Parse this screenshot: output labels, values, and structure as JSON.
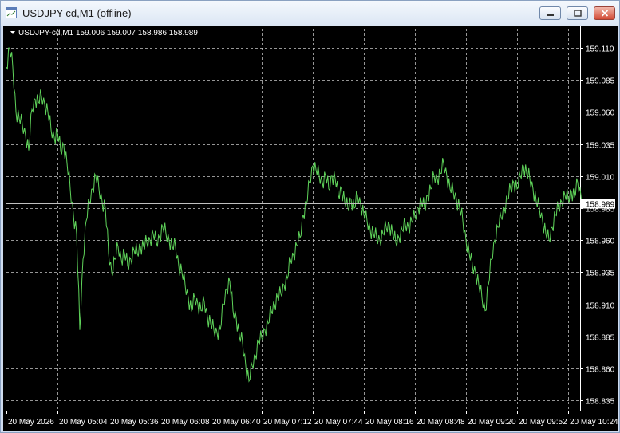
{
  "window": {
    "title": "USDJPY-cd,M1 (offline)",
    "buttons": [
      "minimize",
      "maximize",
      "close"
    ]
  },
  "chart_data": {
    "type": "line",
    "header": {
      "symbol": "USDJPY-cd,M1",
      "ohlc": "159.006 159.007 158.986 158.989"
    },
    "colors": {
      "background": "#000000",
      "bars": "#5fd35a",
      "grid": "#c8c8c8",
      "current_line": "#c0c0c0"
    },
    "grid": true,
    "y_ticks": [
      "159.110",
      "159.085",
      "159.060",
      "159.035",
      "159.010",
      "158.985",
      "158.960",
      "158.935",
      "158.910",
      "158.885",
      "158.860",
      "158.835"
    ],
    "ylim": [
      158.827,
      159.125
    ],
    "current_price": "158.989",
    "x_ticks": [
      "20 May 2026",
      "20 May 05:04",
      "20 May 05:36",
      "20 May 06:08",
      "20 May 06:40",
      "20 May 07:12",
      "20 May 07:44",
      "20 May 08:16",
      "20 May 08:48",
      "20 May 09:20",
      "20 May 09:52",
      "20 May 10:24"
    ],
    "series": [
      {
        "points": [
          [
            0,
            159.095
          ],
          [
            4,
            159.11
          ],
          [
            8,
            159.095
          ],
          [
            12,
            159.06
          ],
          [
            16,
            159.055
          ],
          [
            20,
            159.05
          ],
          [
            24,
            159.042
          ],
          [
            28,
            159.03
          ],
          [
            32,
            159.062
          ],
          [
            36,
            159.07
          ],
          [
            40,
            159.068
          ],
          [
            44,
            159.072
          ],
          [
            48,
            159.066
          ],
          [
            52,
            159.06
          ],
          [
            56,
            159.046
          ],
          [
            60,
            159.04
          ],
          [
            64,
            159.044
          ],
          [
            68,
            159.03
          ],
          [
            72,
            159.034
          ],
          [
            76,
            159.02
          ],
          [
            80,
            159.0
          ],
          [
            84,
            158.98
          ],
          [
            88,
            158.965
          ],
          [
            92,
            158.89
          ],
          [
            96,
            158.945
          ],
          [
            100,
            158.975
          ],
          [
            104,
            158.99
          ],
          [
            108,
            159.0
          ],
          [
            112,
            159.01
          ],
          [
            116,
            159.0
          ],
          [
            120,
            158.99
          ],
          [
            124,
            158.985
          ],
          [
            128,
            158.95
          ],
          [
            132,
            158.935
          ],
          [
            136,
            158.945
          ],
          [
            140,
            158.955
          ],
          [
            144,
            158.945
          ],
          [
            148,
            158.95
          ],
          [
            152,
            158.94
          ],
          [
            156,
            158.945
          ],
          [
            160,
            158.952
          ],
          [
            164,
            158.95
          ],
          [
            168,
            158.955
          ],
          [
            172,
            158.955
          ],
          [
            176,
            158.958
          ],
          [
            180,
            158.96
          ],
          [
            184,
            158.965
          ],
          [
            188,
            158.958
          ],
          [
            192,
            158.962
          ],
          [
            196,
            158.97
          ],
          [
            200,
            158.965
          ],
          [
            204,
            158.96
          ],
          [
            208,
            158.955
          ],
          [
            212,
            158.955
          ],
          [
            216,
            158.94
          ],
          [
            220,
            158.935
          ],
          [
            224,
            158.925
          ],
          [
            228,
            158.915
          ],
          [
            232,
            158.905
          ],
          [
            236,
            158.915
          ],
          [
            240,
            158.91
          ],
          [
            244,
            158.905
          ],
          [
            248,
            158.912
          ],
          [
            252,
            158.9
          ],
          [
            256,
            158.895
          ],
          [
            260,
            158.89
          ],
          [
            264,
            158.888
          ],
          [
            268,
            158.89
          ],
          [
            272,
            158.91
          ],
          [
            276,
            158.922
          ],
          [
            280,
            158.928
          ],
          [
            284,
            158.905
          ],
          [
            288,
            158.9
          ],
          [
            292,
            158.885
          ],
          [
            296,
            158.88
          ],
          [
            300,
            158.862
          ],
          [
            304,
            158.85
          ],
          [
            308,
            158.862
          ],
          [
            312,
            158.87
          ],
          [
            316,
            158.88
          ],
          [
            320,
            158.884
          ],
          [
            324,
            158.89
          ],
          [
            328,
            158.895
          ],
          [
            332,
            158.905
          ],
          [
            336,
            158.91
          ],
          [
            340,
            158.915
          ],
          [
            344,
            158.918
          ],
          [
            348,
            158.925
          ],
          [
            352,
            158.93
          ],
          [
            356,
            158.945
          ],
          [
            360,
            158.948
          ],
          [
            364,
            158.956
          ],
          [
            368,
            158.962
          ],
          [
            372,
            158.98
          ],
          [
            376,
            158.988
          ],
          [
            380,
            159.005
          ],
          [
            384,
            159.018
          ],
          [
            388,
            159.015
          ],
          [
            392,
            159.01
          ],
          [
            396,
            159.005
          ],
          [
            400,
            159.01
          ],
          [
            404,
            159.0
          ],
          [
            408,
            159.01
          ],
          [
            412,
            159.008
          ],
          [
            416,
            158.995
          ],
          [
            420,
            159.0
          ],
          [
            424,
            158.99
          ],
          [
            428,
            158.985
          ],
          [
            432,
            158.992
          ],
          [
            436,
            158.985
          ],
          [
            440,
            158.995
          ],
          [
            444,
            158.988
          ],
          [
            448,
            158.98
          ],
          [
            452,
            158.975
          ],
          [
            456,
            158.968
          ],
          [
            460,
            158.965
          ],
          [
            464,
            158.962
          ],
          [
            468,
            158.96
          ],
          [
            472,
            158.965
          ],
          [
            476,
            158.97
          ],
          [
            480,
            158.972
          ],
          [
            484,
            158.965
          ],
          [
            488,
            158.958
          ],
          [
            492,
            158.962
          ],
          [
            496,
            158.968
          ],
          [
            500,
            158.972
          ],
          [
            504,
            158.97
          ],
          [
            508,
            158.975
          ],
          [
            512,
            158.978
          ],
          [
            516,
            158.985
          ],
          [
            520,
            158.99
          ],
          [
            524,
            158.985
          ],
          [
            528,
            158.995
          ],
          [
            532,
            159.0
          ],
          [
            536,
            159.01
          ],
          [
            540,
            159.008
          ],
          [
            544,
            159.012
          ],
          [
            548,
            159.02
          ],
          [
            552,
            159.01
          ],
          [
            556,
            159.0
          ],
          [
            560,
            158.998
          ],
          [
            564,
            158.992
          ],
          [
            568,
            158.985
          ],
          [
            572,
            158.975
          ],
          [
            576,
            158.96
          ],
          [
            580,
            158.95
          ],
          [
            584,
            158.94
          ],
          [
            588,
            158.935
          ],
          [
            592,
            158.925
          ],
          [
            596,
            158.915
          ],
          [
            600,
            158.905
          ],
          [
            604,
            158.925
          ],
          [
            608,
            158.945
          ],
          [
            612,
            158.96
          ],
          [
            616,
            158.97
          ],
          [
            620,
            158.978
          ],
          [
            624,
            158.985
          ],
          [
            628,
            158.992
          ],
          [
            632,
            159.0
          ],
          [
            636,
            159.005
          ],
          [
            640,
            159.0
          ],
          [
            644,
            159.01
          ],
          [
            648,
            159.018
          ],
          [
            652,
            159.012
          ],
          [
            656,
            159.008
          ],
          [
            660,
            159.0
          ],
          [
            664,
            158.99
          ],
          [
            668,
            158.985
          ],
          [
            672,
            158.975
          ],
          [
            676,
            158.965
          ],
          [
            680,
            158.96
          ],
          [
            684,
            158.97
          ],
          [
            688,
            158.98
          ],
          [
            692,
            158.985
          ],
          [
            696,
            158.99
          ],
          [
            700,
            158.995
          ],
          [
            704,
            158.992
          ],
          [
            708,
            158.998
          ],
          [
            712,
            158.994
          ],
          [
            716,
            159.005
          ],
          [
            720,
            158.995
          ],
          [
            723,
            158.989
          ]
        ]
      }
    ]
  }
}
